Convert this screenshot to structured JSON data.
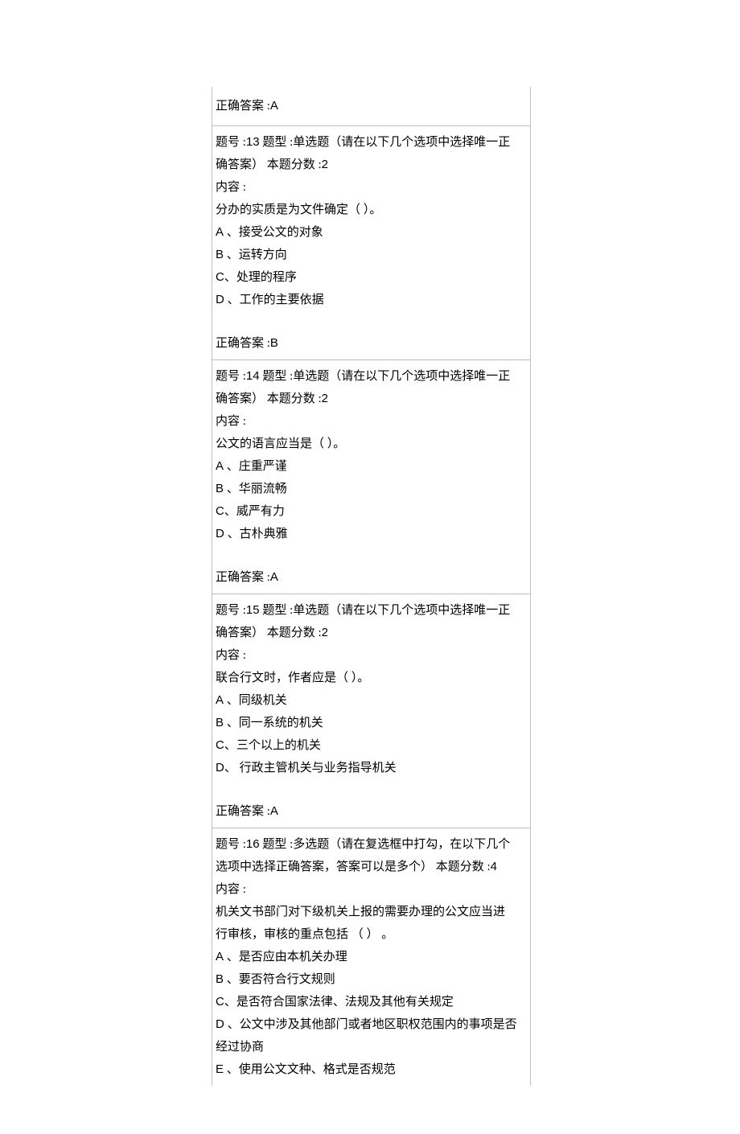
{
  "cells": [
    {
      "type": "answer",
      "lines": [
        [
          {
            "t": "正确答案 :"
          },
          {
            "t": "A",
            "cls": "letter"
          }
        ]
      ]
    },
    {
      "type": "question",
      "lines": [
        [
          {
            "t": "题号 :"
          },
          {
            "t": "13",
            "cls": "letter"
          },
          {
            "t": "    题型 :单选题（请在以下几个选项中选择唯一正"
          }
        ],
        [
          {
            "t": "确答案）    本题分数  :"
          },
          {
            "t": "2",
            "cls": "letter"
          }
        ],
        [
          {
            "t": "内容 :"
          }
        ],
        [
          {
            "t": "分办的实质是为文件确定（       ）。"
          }
        ],
        [
          {
            "t": "A",
            "cls": "letter"
          },
          {
            "t": " 、接受公文的对象"
          }
        ],
        [
          {
            "t": "B",
            "cls": "letter"
          },
          {
            "t": " 、运转方向"
          }
        ],
        [
          {
            "t": "C",
            "cls": "letter"
          },
          {
            "t": "、处理的程序"
          }
        ],
        [
          {
            "t": "D",
            "cls": "letter"
          },
          {
            "t": " 、工作的主要依据"
          }
        ],
        [
          {
            "spacer": true
          }
        ],
        [
          {
            "t": "正确答案 :"
          },
          {
            "t": "B",
            "cls": "letter"
          }
        ]
      ]
    },
    {
      "type": "question",
      "lines": [
        [
          {
            "t": "题号 :"
          },
          {
            "t": "14",
            "cls": "letter"
          },
          {
            "t": "    题型 :单选题（请在以下几个选项中选择唯一正"
          }
        ],
        [
          {
            "t": "确答案）    本题分数  :"
          },
          {
            "t": "2",
            "cls": "letter"
          }
        ],
        [
          {
            "t": "内容 :"
          }
        ],
        [
          {
            "t": "公文的语言应当是（      ）。"
          }
        ],
        [
          {
            "t": "A",
            "cls": "letter"
          },
          {
            "t": " 、庄重严谨"
          }
        ],
        [
          {
            "t": "B",
            "cls": "letter"
          },
          {
            "t": " 、华丽流畅"
          }
        ],
        [
          {
            "t": "C",
            "cls": "letter"
          },
          {
            "t": "、威严有力"
          }
        ],
        [
          {
            "t": "D",
            "cls": "letter"
          },
          {
            "t": " 、古朴典雅"
          }
        ],
        [
          {
            "spacer": true
          }
        ],
        [
          {
            "t": "正确答案 :"
          },
          {
            "t": "A",
            "cls": "letter"
          }
        ]
      ]
    },
    {
      "type": "question",
      "lines": [
        [
          {
            "t": "题号 :"
          },
          {
            "t": "15",
            "cls": "letter"
          },
          {
            "t": "    题型 :单选题（请在以下几个选项中选择唯一正"
          }
        ],
        [
          {
            "t": "确答案）    本题分数  :"
          },
          {
            "t": "2",
            "cls": "letter"
          }
        ],
        [
          {
            "t": "内容 :"
          }
        ],
        [
          {
            "t": "联合行文时，作者应是（       ）。"
          }
        ],
        [
          {
            "t": "A",
            "cls": "letter"
          },
          {
            "t": " 、同级机关"
          }
        ],
        [
          {
            "t": "B",
            "cls": "letter"
          },
          {
            "t": " 、同一系统的机关"
          }
        ],
        [
          {
            "t": "C",
            "cls": "letter"
          },
          {
            "t": "、三个以上的机关"
          }
        ],
        [
          {
            "t": "D",
            "cls": "letter"
          },
          {
            "t": "、   行政主管机关与业务指导机关"
          }
        ],
        [
          {
            "spacer": true
          }
        ],
        [
          {
            "t": "正确答案 :"
          },
          {
            "t": "A",
            "cls": "letter"
          }
        ]
      ]
    },
    {
      "type": "question_open",
      "lines": [
        [
          {
            "t": "题号 :"
          },
          {
            "t": "16",
            "cls": "letter"
          },
          {
            "t": "    题型 :多选题（请在复选框中打勾，在以下几个"
          }
        ],
        [
          {
            "t": "选项中选择正确答案，答案可以是多个）          本题分数  :"
          },
          {
            "t": "4",
            "cls": "letter"
          }
        ],
        [
          {
            "t": "内容 :"
          }
        ],
        [
          {
            "t": "机关文书部门对下级机关上报的需要办理的公文应当进"
          }
        ],
        [
          {
            "t": "行审核，审核的重点包括       （  ）  。"
          }
        ],
        [
          {
            "t": "A",
            "cls": "letter"
          },
          {
            "t": " 、是否应由本机关办理"
          }
        ],
        [
          {
            "t": "B",
            "cls": "letter"
          },
          {
            "t": " 、要否符合行文规则"
          }
        ],
        [
          {
            "t": "C",
            "cls": "letter"
          },
          {
            "t": "、是否符合国家法律、法规及其他有关规定"
          }
        ],
        [
          {
            "t": "D",
            "cls": "letter"
          },
          {
            "t": " 、公文中涉及其他部门或者地区职权范围内的事项是否"
          }
        ],
        [
          {
            "t": "经过协商"
          }
        ],
        [
          {
            "t": "E",
            "cls": "letter"
          },
          {
            "t": " 、使用公文文种、格式是否规范"
          }
        ]
      ]
    }
  ]
}
